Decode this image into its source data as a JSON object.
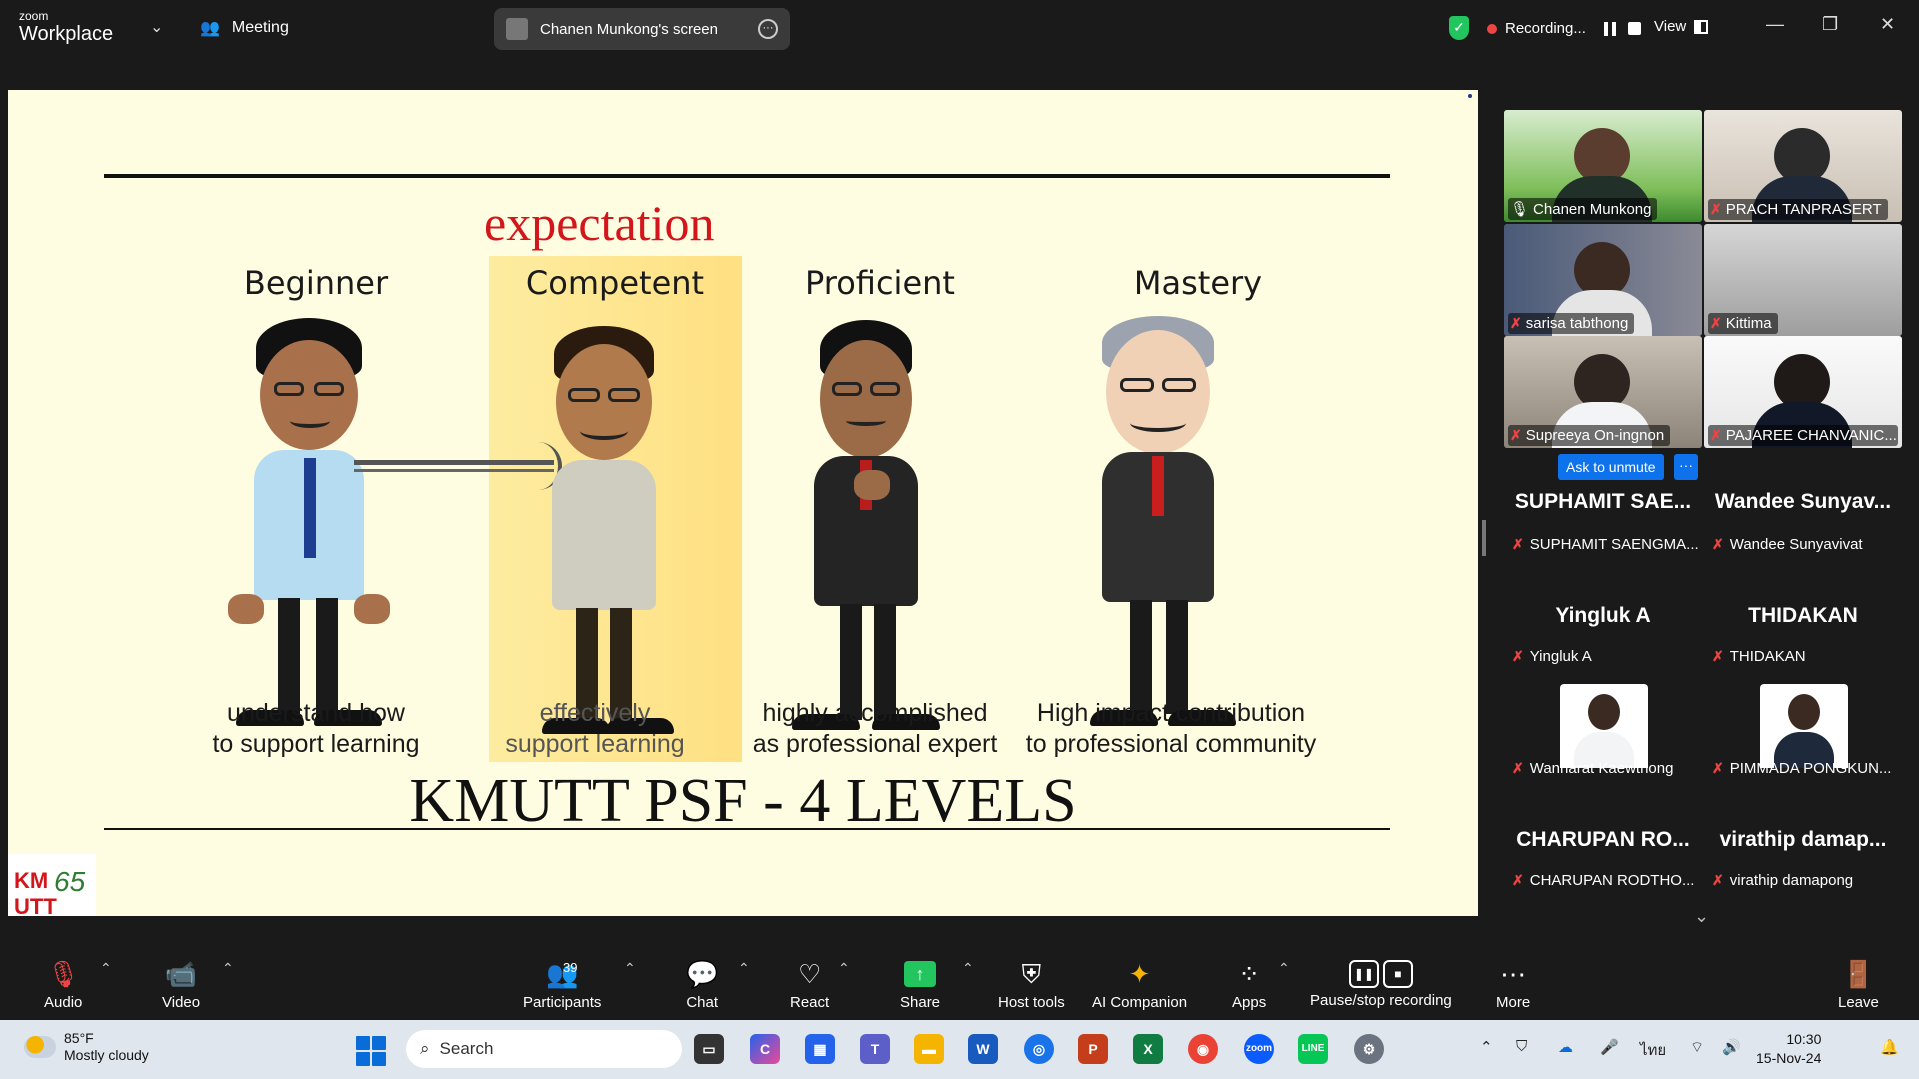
{
  "titlebar": {
    "brand_small": "zoom",
    "brand_big": "Workplace",
    "meeting_label": "Meeting",
    "screen_share_label": "Chanen Munkong's screen",
    "recording_label": "Recording...",
    "view_label": "View"
  },
  "slide": {
    "expectation": "expectation",
    "levels": [
      {
        "title": "Beginner",
        "desc1": "understand how",
        "desc2": "to support learning"
      },
      {
        "title": "Competent",
        "desc1": "effectively",
        "desc2": "support learning"
      },
      {
        "title": "Proficient",
        "desc1": "highly accomplished",
        "desc2": "as professional expert"
      },
      {
        "title": "Mastery",
        "desc1": "High impact contribution",
        "desc2": "to professional community"
      }
    ],
    "footer_title": "KMUTT PSF - 4 LEVELS",
    "logo_text": "KM UTT",
    "logo_65": "65"
  },
  "gallery": {
    "video_tiles": [
      {
        "name": "Chanen Munkong",
        "active": true
      },
      {
        "name": "PRACH TANPRASERT"
      },
      {
        "name": "sarisa tabthong"
      },
      {
        "name": "Kittima"
      },
      {
        "name": "Supreeya On-ingnon"
      },
      {
        "name": "PAJAREE CHANVANIC..."
      }
    ],
    "ask_to_unmute": "Ask to unmute",
    "ask_more": "···",
    "name_tiles": [
      {
        "big": "SUPHAMIT SAE...",
        "small": "SUPHAMIT SAENGMA..."
      },
      {
        "big": "Wandee Sunyav...",
        "small": "Wandee Sunyavivat"
      },
      {
        "big": "Yingluk A",
        "small": "Yingluk A"
      },
      {
        "big": "THIDAKAN",
        "small": "THIDAKAN"
      },
      {
        "small": "Wannarat Kaewthong"
      },
      {
        "small": "PIMMADA PONGKUN..."
      },
      {
        "big": "CHARUPAN RO...",
        "small": "CHARUPAN RODTHO..."
      },
      {
        "big": "virathip damap...",
        "small": "virathip damapong"
      }
    ]
  },
  "toolbar": {
    "audio": "Audio",
    "video": "Video",
    "participants": "Participants",
    "participants_count": "39",
    "chat": "Chat",
    "react": "React",
    "share": "Share",
    "host_tools": "Host tools",
    "ai_companion": "AI Companion",
    "apps": "Apps",
    "pause_recording": "Pause/stop recording",
    "more": "More",
    "leave": "Leave"
  },
  "taskbar": {
    "temp": "85°F",
    "weather": "Mostly cloudy",
    "search_placeholder": "Search",
    "lang": "ไทย",
    "time": "10:30",
    "date": "15-Nov-24"
  },
  "colors": {
    "slide_bg": "#fffde1",
    "expectation_red": "#d3161b",
    "highlight": "#fde58a",
    "active_speaker": "#22c55e",
    "zoom_blue": "#0e72ed"
  }
}
